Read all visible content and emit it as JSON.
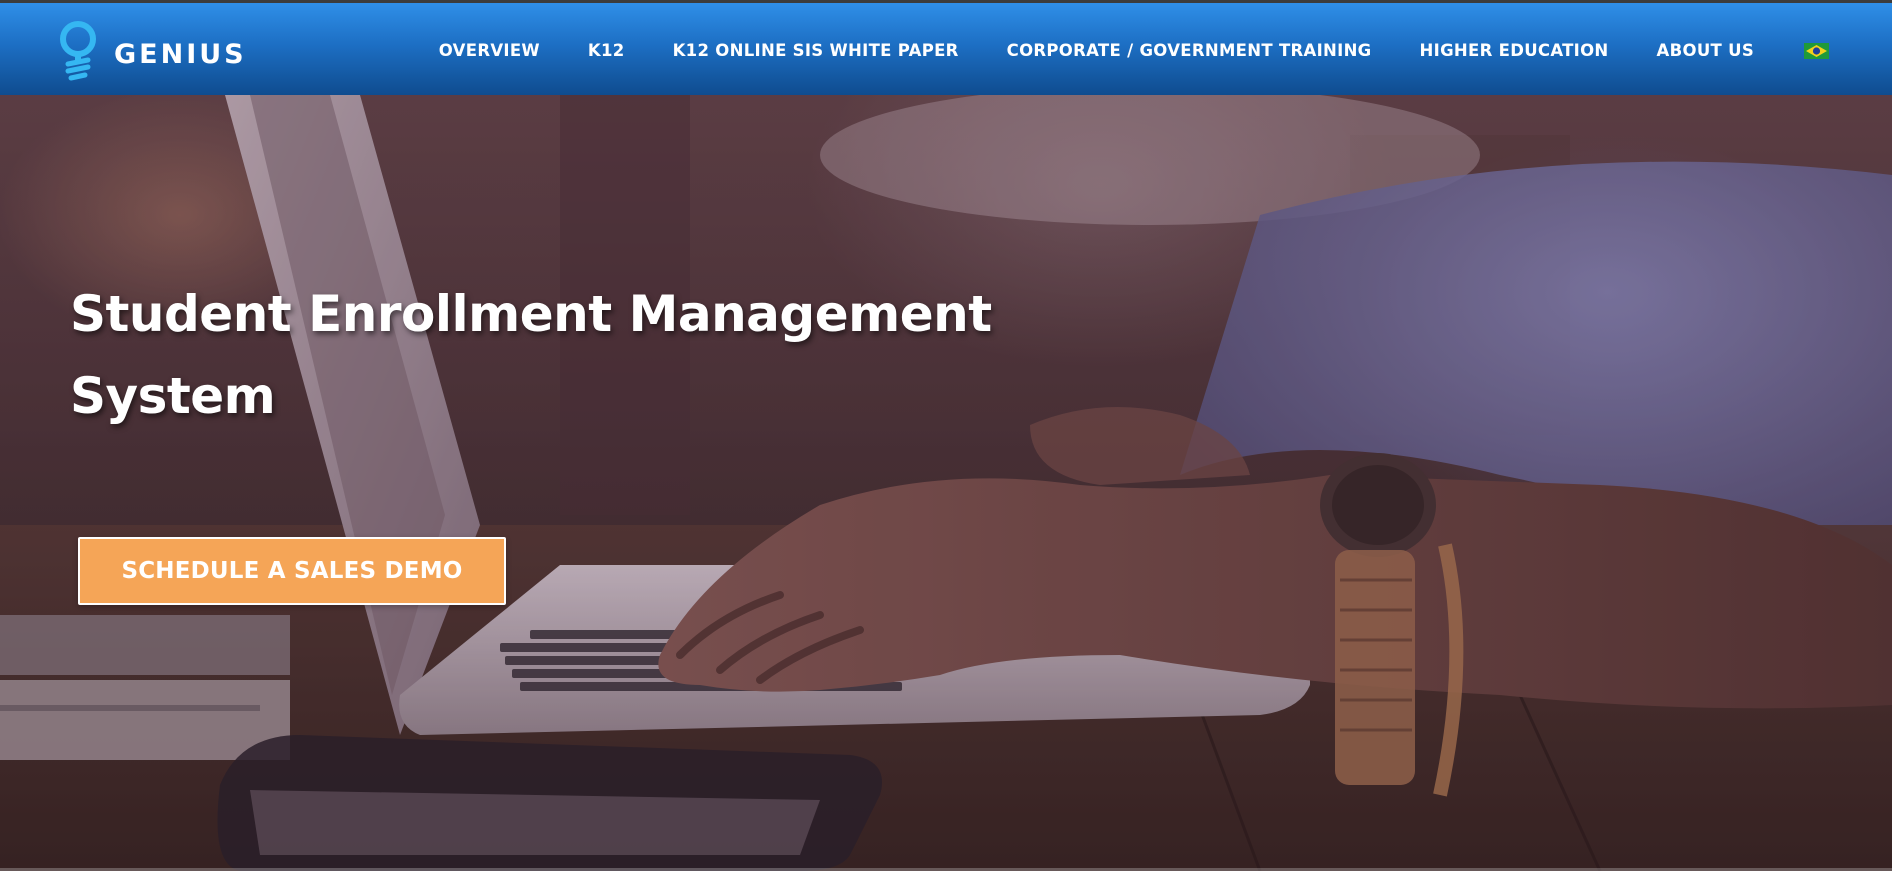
{
  "brand": {
    "name": "GENIUS",
    "logo_icon": "lightbulb-icon",
    "accent": "#2f8fe8"
  },
  "nav": {
    "items": [
      {
        "label": "OVERVIEW"
      },
      {
        "label": "K12"
      },
      {
        "label": "K12 ONLINE SIS WHITE PAPER"
      },
      {
        "label": "CORPORATE / GOVERNMENT TRAINING"
      },
      {
        "label": "HIGHER EDUCATION"
      },
      {
        "label": "ABOUT US"
      }
    ],
    "language_flag_icon": "brazil-flag-icon"
  },
  "hero": {
    "title": "Student Enrollment Management System",
    "cta_label": "SCHEDULE A SALES DEMO",
    "cta_color": "#f5a557"
  }
}
